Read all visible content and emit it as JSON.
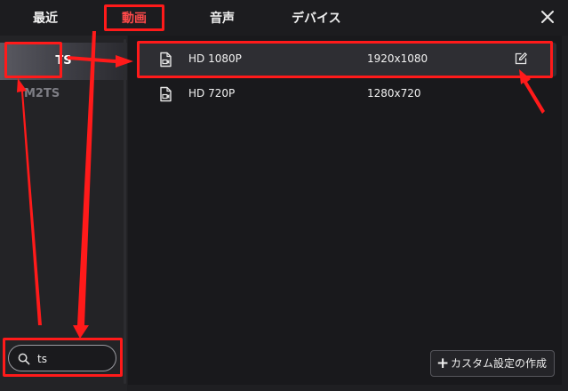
{
  "tabs": [
    {
      "label": "最近",
      "active": false
    },
    {
      "label": "動画",
      "active": true
    },
    {
      "label": "音声",
      "active": false
    },
    {
      "label": "デバイス",
      "active": false
    }
  ],
  "close_icon": "close-icon",
  "sidebar": {
    "items": [
      {
        "label": "TS",
        "selected": true
      },
      {
        "label": "M2TS",
        "selected": false
      }
    ]
  },
  "search": {
    "icon": "search-icon",
    "value": "ts"
  },
  "presets": [
    {
      "name": "HD 1080P",
      "resolution": "1920x1080",
      "selected": true,
      "icon": "video-file-icon",
      "edit_icon": "edit-icon"
    },
    {
      "name": "HD 720P",
      "resolution": "1280x720",
      "selected": false,
      "icon": "video-file-icon"
    }
  ],
  "custom_button": {
    "icon": "plus-icon",
    "label": "カスタム設定の作成"
  },
  "colors": {
    "accent": "#ff4a4a",
    "annotation": "#ff1a1a",
    "background": "#1f1f22"
  }
}
